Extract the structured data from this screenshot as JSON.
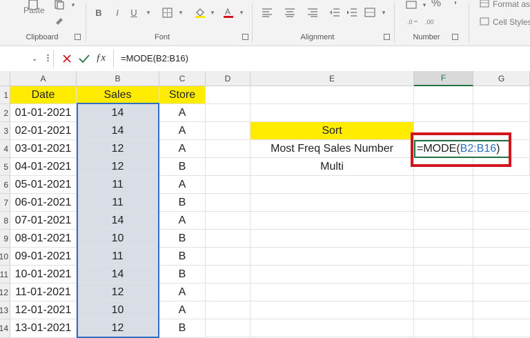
{
  "ribbon": {
    "paste_label": "Paste",
    "clipboard_label": "Clipboard",
    "font_label": "Font",
    "alignment_label": "Alignment",
    "number_label": "Number",
    "format_as_label": "Format as",
    "cell_styles_label": "Cell Styles",
    "bold": "B",
    "italic": "I",
    "underline": "U",
    "percent": "%"
  },
  "formula_bar": {
    "formula": "=MODE(B2:B16)"
  },
  "columns": [
    "A",
    "B",
    "C",
    "D",
    "E",
    "F",
    "G"
  ],
  "rows": [
    "1",
    "2",
    "3",
    "4",
    "5",
    "6",
    "7",
    "8",
    "9",
    "10",
    "11",
    "12",
    "13",
    "14"
  ],
  "table": {
    "headers": {
      "date": "Date",
      "sales": "Sales",
      "store": "Store"
    },
    "data": [
      {
        "date": "01-01-2021",
        "sales": "14",
        "store": "A"
      },
      {
        "date": "02-01-2021",
        "sales": "14",
        "store": "A"
      },
      {
        "date": "03-01-2021",
        "sales": "12",
        "store": "A"
      },
      {
        "date": "04-01-2021",
        "sales": "12",
        "store": "B"
      },
      {
        "date": "05-01-2021",
        "sales": "11",
        "store": "A"
      },
      {
        "date": "06-01-2021",
        "sales": "11",
        "store": "B"
      },
      {
        "date": "07-01-2021",
        "sales": "14",
        "store": "A"
      },
      {
        "date": "08-01-2021",
        "sales": "10",
        "store": "B"
      },
      {
        "date": "09-01-2021",
        "sales": "11",
        "store": "B"
      },
      {
        "date": "10-01-2021",
        "sales": "14",
        "store": "B"
      },
      {
        "date": "11-01-2021",
        "sales": "12",
        "store": "A"
      },
      {
        "date": "12-01-2021",
        "sales": "10",
        "store": "A"
      },
      {
        "date": "13-01-2021",
        "sales": "12",
        "store": "B"
      }
    ]
  },
  "side": {
    "sort": "Sort",
    "most_freq": "Most Freq Sales Number",
    "multi": "Multi",
    "active_cell": "=MODE(B2:B16)"
  },
  "colors": {
    "yellow": "#ffec00",
    "highlight_box": "#d0151c",
    "excel_green": "#217346",
    "ref_blue": "#2f6fbf"
  }
}
